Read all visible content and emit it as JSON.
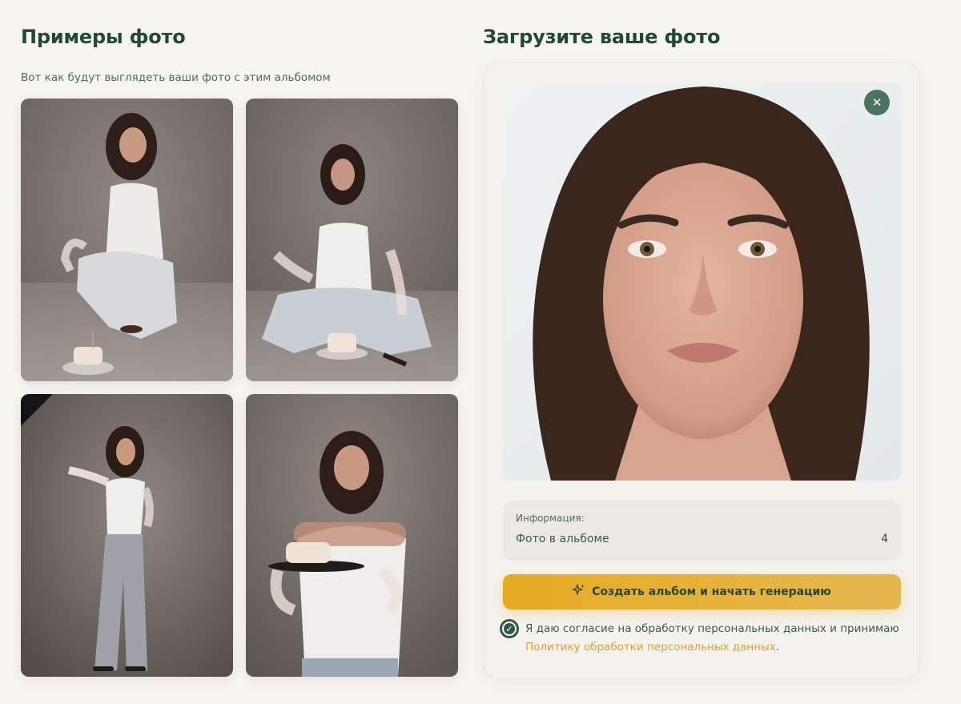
{
  "examples": {
    "title": "Примеры фото",
    "subtitle": "Вот как будут выглядеть ваши фото с этим альбомом",
    "photos": [
      {
        "alt": "Женщина в белом корсете сидит на корточках рядом с тортом"
      },
      {
        "alt": "Женщина в белом корсете сидит, скрестив ноги, рядом с тортом"
      },
      {
        "alt": "Женщина в белом корсете стоит с жемчужным ожерельем"
      },
      {
        "alt": "Женщина в белом корсете держит торт на тарелке"
      }
    ]
  },
  "upload": {
    "title": "Загрузите ваше фото",
    "photo_alt": "Портрет загруженного фото",
    "close_icon": "close-icon",
    "info": {
      "label": "Информация:",
      "photos_label": "Фото в альбоме",
      "photos_count": "4"
    },
    "create_button": "Создать альбом и начать генерацию",
    "create_icon": "sparkle-icon",
    "consent_text": "Я даю согласие на обработку персональных данных и принимаю",
    "consent_link": "Политику обработки персональных данных",
    "consent_end": ".",
    "consent_checked": true
  },
  "colors": {
    "heading": "#1f4a36",
    "accent": "#e7ab22",
    "link": "#d9a02d",
    "close_button": "#4a735f",
    "checkbox": "#2f5a47",
    "background": "#f7f5f0"
  }
}
